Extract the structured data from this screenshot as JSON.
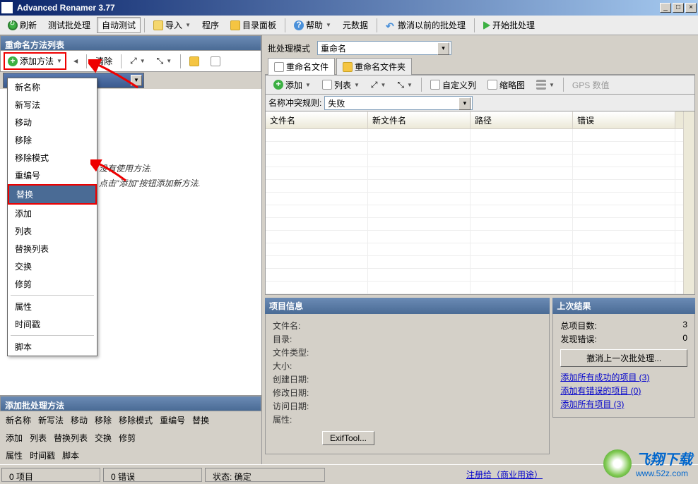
{
  "window": {
    "title": "Advanced Renamer 3.77"
  },
  "toolbar": {
    "refresh": "刷新",
    "test_batch": "测试批处理",
    "auto_test": "自动测试",
    "import": "导入",
    "program": "程序",
    "dir_panel": "目录面板",
    "help": "帮助",
    "metadata": "元数据",
    "undo_before": "撤消以前的批处理",
    "start_batch": "开始批处理"
  },
  "left": {
    "header": "重命名方法列表",
    "add_method": "添加方法",
    "clear": "清除",
    "menu": {
      "items": [
        "新名称",
        "新写法",
        "移动",
        "移除",
        "移除模式",
        "重编号",
        "替换",
        "添加",
        "列表",
        "替换列表",
        "交换",
        "修剪",
        "属性",
        "时间戳",
        "脚本"
      ],
      "highlighted": "替换"
    },
    "empty1": "没有使用方法.",
    "empty2": "点击\"添加\"按钮添加新方法.",
    "bottom_header": "添加批处理方法",
    "links1": [
      "新名称",
      "新写法",
      "移动",
      "移除",
      "移除模式",
      "重编号",
      "替换"
    ],
    "links2": [
      "添加",
      "列表",
      "替换列表",
      "交换",
      "修剪"
    ],
    "links3": [
      "属性",
      "时间戳",
      "脚本"
    ]
  },
  "right": {
    "mode_label": "批处理模式",
    "mode_value": "重命名",
    "tabs": {
      "files": "重命名文件",
      "folders": "重命名文件夹"
    },
    "toolbar": {
      "add": "添加",
      "list": "列表",
      "custom_cols": "自定义列",
      "thumbs": "缩略图",
      "gps": "GPS 数值"
    },
    "conflict_label": "名称冲突规则:",
    "conflict_value": "失败",
    "columns": [
      "文件名",
      "新文件名",
      "路径",
      "错误"
    ],
    "info": {
      "header": "项目信息",
      "fields": {
        "filename": "文件名:",
        "dir": "目录:",
        "filetype": "文件类型:",
        "size": "大小:",
        "created": "创建日期:",
        "modified": "修改日期:",
        "accessed": "访问日期:",
        "attrs": "属性:"
      },
      "exif_btn": "ExifTool..."
    },
    "result": {
      "header": "上次结果",
      "total_label": "总项目数:",
      "total_value": "3",
      "errors_label": "发现错误:",
      "errors_value": "0",
      "undo_btn": "撤消上一次批处理...",
      "link1": "添加所有成功的项目 (3)",
      "link2": "添加有错误的项目 (0)",
      "link3": "添加所有项目 (3)"
    }
  },
  "status": {
    "items": "0 项目",
    "errors": "0 错误",
    "state_label": "状态:",
    "state_value": "确定",
    "register": "注册给（商业用途）"
  },
  "watermark": {
    "brand": "飞翔下载",
    "url": "www.52z.com"
  }
}
